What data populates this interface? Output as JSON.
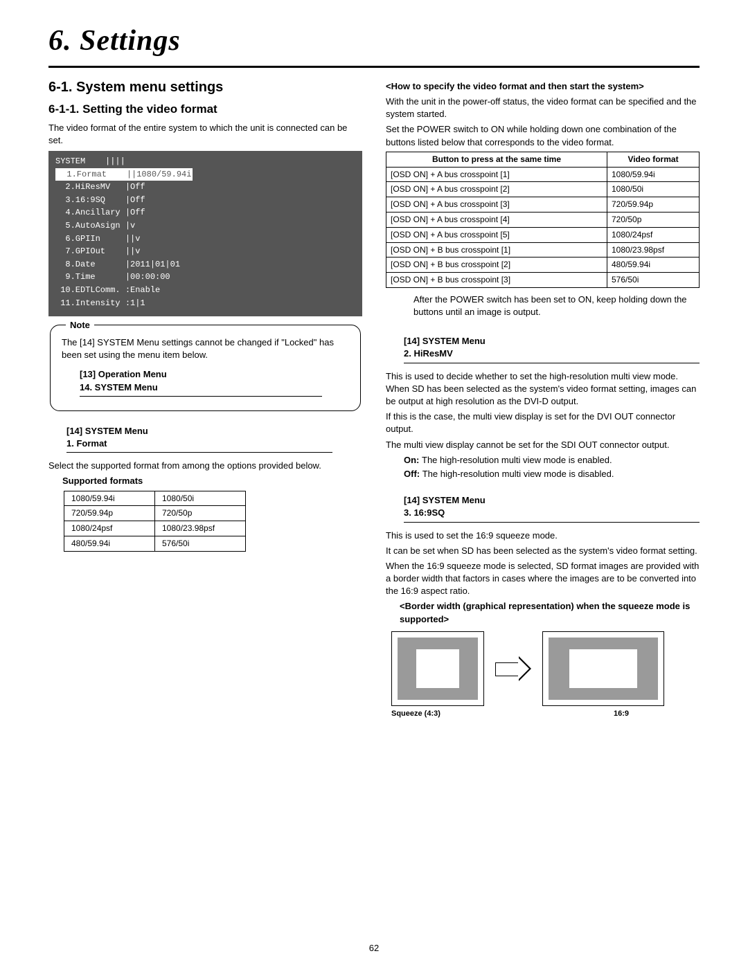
{
  "chapter_title": "6. Settings",
  "left": {
    "section": "6-1. System menu settings",
    "subsection": "6-1-1. Setting the video format",
    "intro": "The video format of the entire system to which the unit is connected can be set.",
    "osd": {
      "header": "SYSTEM    ||||",
      "rows": [
        [
          "  1.",
          "Format",
          "||",
          "1080/59.94i"
        ],
        [
          "  2.",
          "HiResMV",
          "|",
          "Off"
        ],
        [
          "  3.",
          "16:9SQ",
          "|",
          "Off"
        ],
        [
          "  4.",
          "Ancillary",
          "|",
          "Off"
        ],
        [
          "  5.",
          "AutoAsign",
          "|",
          "v"
        ],
        [
          "  6.",
          "GPIIn",
          "||",
          "v"
        ],
        [
          "  7.",
          "GPIOut",
          "||",
          "v"
        ],
        [
          "  8.",
          "Date",
          "|",
          "2011|01|01"
        ],
        [
          "  9.",
          "Time",
          "|",
          "00:00:00"
        ],
        [
          " 10.",
          "EDTLComm.",
          ":",
          "Enable"
        ],
        [
          " 11.",
          "Intensity",
          ":",
          "1|1"
        ]
      ]
    },
    "note_label": "Note",
    "note_text": "The [14] SYSTEM Menu settings cannot be changed if \"Locked\" has been set using the menu item below.",
    "note_menu_line1": "[13] Operation Menu",
    "note_menu_line2": "14. SYSTEM Menu",
    "menu1_line1": "[14] SYSTEM Menu",
    "menu1_line2": "1. Format",
    "select_text": "Select the supported format from among the options provided below.",
    "supported_label": "Supported formats",
    "supported": [
      [
        "1080/59.94i",
        "1080/50i"
      ],
      [
        "720/59.94p",
        "720/50p"
      ],
      [
        "1080/24psf",
        "1080/23.98psf"
      ],
      [
        "480/59.94i",
        "576/50i"
      ]
    ]
  },
  "right": {
    "howto_title": "<How to specify the video format and then start the system>",
    "howto_p1": "With the unit in the power-off status, the video format can be specified and the system started.",
    "howto_p2": "Set the POWER switch to ON while holding down one combination of the buttons listed below that corresponds to the video format.",
    "table_h1": "Button to press at the same time",
    "table_h2": "Video format",
    "table_rows": [
      [
        "[OSD ON] + A bus crosspoint [1]",
        "1080/59.94i"
      ],
      [
        "[OSD ON] + A bus crosspoint [2]",
        "1080/50i"
      ],
      [
        "[OSD ON] + A bus crosspoint [3]",
        "720/59.94p"
      ],
      [
        "[OSD ON] + A bus crosspoint [4]",
        "720/50p"
      ],
      [
        "[OSD ON] + A bus crosspoint [5]",
        "1080/24psf"
      ],
      [
        "[OSD ON] + B bus crosspoint [1]",
        "1080/23.98psf"
      ],
      [
        "[OSD ON] + B bus crosspoint [2]",
        "480/59.94i"
      ],
      [
        "[OSD ON] + B bus crosspoint [3]",
        "576/50i"
      ]
    ],
    "after_power": "After the POWER switch has been set to ON, keep holding down the buttons until an image is output.",
    "menu2_line1": "[14] SYSTEM Menu",
    "menu2_line2": "2. HiResMV",
    "hires_p1": "This is used to decide whether to set the high-resolution multi view mode. When SD has been selected as the system's video format setting, images can be output at high resolution as the DVI-D output.",
    "hires_p2": "If this is the case, the multi view display is set for the DVI OUT connector output.",
    "hires_p3": "The multi view display cannot be set for the SDI OUT connector output.",
    "on_label": "On:",
    "on_text": "The high-resolution multi view mode is enabled.",
    "off_label": "Off:",
    "off_text": "The high-resolution multi view mode is disabled.",
    "menu3_line1": "[14] SYSTEM Menu",
    "menu3_line2": "3. 16:9SQ",
    "sq_p1": "This is used to set the 16:9 squeeze mode.",
    "sq_p2": "It can be set when SD has been selected as the system's video format setting.",
    "sq_p3": "When the 16:9 squeeze mode is selected, SD format images are provided with a border width that factors in cases where the images are to be converted into the 16:9 aspect ratio.",
    "border_title": "<Border width (graphical representation) when the squeeze mode is supported>",
    "caption1": "Squeeze (4:3)",
    "caption2": "16:9"
  },
  "page_number": "62"
}
